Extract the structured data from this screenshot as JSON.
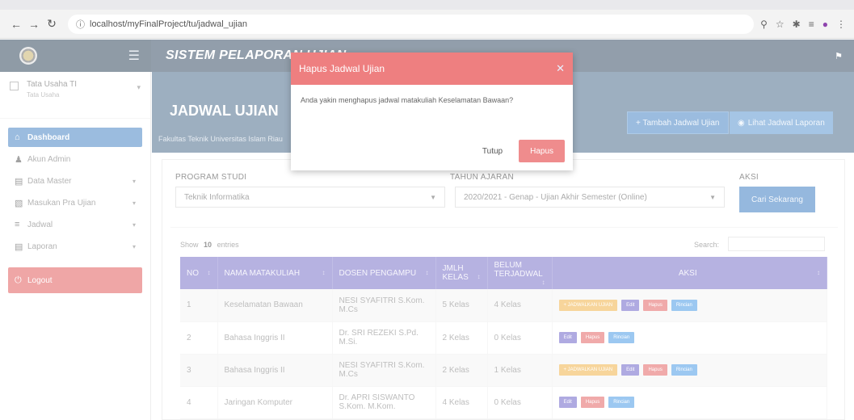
{
  "browser": {
    "url": "localhost/myFinalProject/tu/jadwal_ujian"
  },
  "header": {
    "app_title": "SISTEM PELAPORAN UJIAN"
  },
  "sidebar": {
    "user_name": "Tata Usaha TI",
    "user_role": "Tata Usaha",
    "items": [
      {
        "label": "Dashboard",
        "icon": "home-icon"
      },
      {
        "label": "Akun Admin",
        "icon": "user-icon"
      },
      {
        "label": "Data Master",
        "icon": "database-icon"
      },
      {
        "label": "Masukan Pra Ujian",
        "icon": "input-icon"
      },
      {
        "label": "Jadwal",
        "icon": "list-icon"
      },
      {
        "label": "Laporan",
        "icon": "report-icon"
      },
      {
        "label": "Logout",
        "icon": "power-icon"
      }
    ]
  },
  "page": {
    "title": "JADWAL UJIAN",
    "subtitle": "Fakultas Teknik Universitas Islam Riau",
    "add_button": "+ Tambah Jadwal Ujian",
    "report_button": "Lihat Jadwal Laporan"
  },
  "filters": {
    "program_label": "PROGRAM STUDI",
    "program_value": "Teknik Informatika",
    "year_label": "TAHUN AJARAN",
    "year_value": "2020/2021 - Genap - Ujian Akhir Semester (Online)",
    "action_label": "AKSI",
    "search_button": "Cari Sekarang"
  },
  "table": {
    "show_prefix": "Show",
    "show_value": "10",
    "show_suffix": "entries",
    "search_label": "Search:",
    "headers": [
      "NO",
      "NAMA MATAKULIAH",
      "DOSEN PENGAMPU",
      "JMLH KELAS",
      "BELUM TERJADWAL",
      "AKSI"
    ],
    "rows": [
      {
        "no": "1",
        "matkul": "Keselamatan Bawaan",
        "dosen": "NESI SYAFITRI S.Kom. M.Cs",
        "kelas": "5 Kelas",
        "belum": "4 Kelas",
        "actions": [
          "+ JADWALKAN UJIAN",
          "Edit",
          "Hapus",
          "Rincian"
        ]
      },
      {
        "no": "2",
        "matkul": "Bahasa Inggris II",
        "dosen": "Dr. SRI REZEKI S.Pd. M.Si.",
        "kelas": "2 Kelas",
        "belum": "0 Kelas",
        "actions": [
          "Edit",
          "Hapus",
          "Rincian"
        ]
      },
      {
        "no": "3",
        "matkul": "Bahasa Inggris II",
        "dosen": "NESI SYAFITRI S.Kom. M.Cs",
        "kelas": "2 Kelas",
        "belum": "1 Kelas",
        "actions": [
          "+ JADWALKAN UJIAN",
          "Edit",
          "Hapus",
          "Rincian"
        ]
      },
      {
        "no": "4",
        "matkul": "Jaringan Komputer",
        "dosen": "Dr. APRI SISWANTO S.Kom. M.Kom.",
        "kelas": "4 Kelas",
        "belum": "0 Kelas",
        "actions": [
          "Edit",
          "Hapus",
          "Rincian"
        ]
      }
    ]
  },
  "modal": {
    "title": "Hapus Jadwal Ujian",
    "message": "Anda yakin menghapus jadwal matakuliah Keselamatan Bawaan?",
    "close_button": "Tutup",
    "delete_button": "Hapus"
  },
  "colors": {
    "header": "#3a4f66",
    "accent": "#4a86c5",
    "table_header": "#7a73c9",
    "danger": "#ee7f80"
  }
}
